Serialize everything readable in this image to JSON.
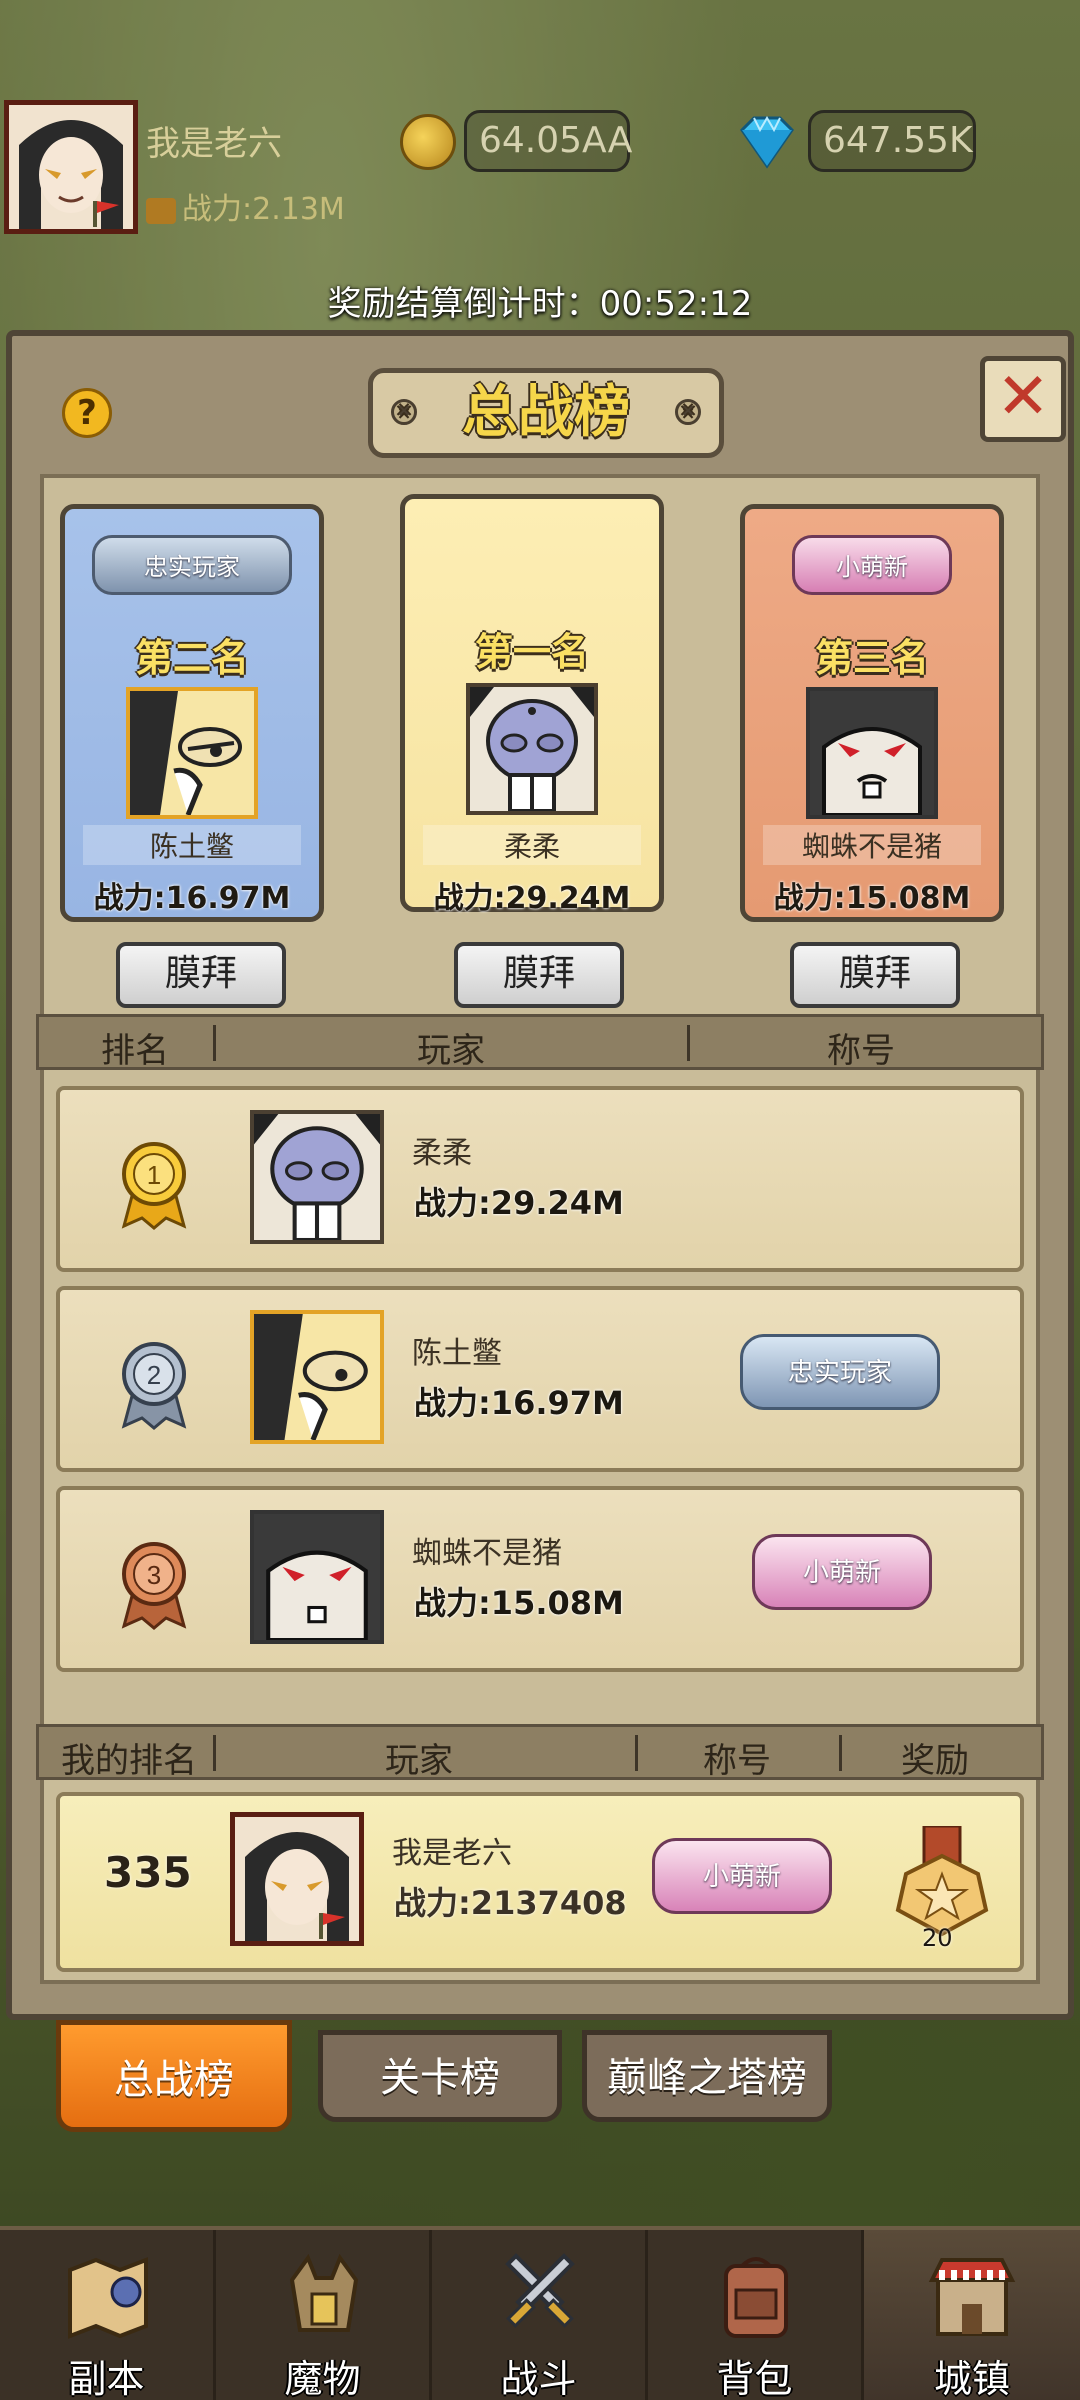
{
  "player": {
    "name": "我是老六",
    "power": "战力:2.13M",
    "gold": "64.05AA",
    "gems": "647.55K"
  },
  "countdown": "奖励结算倒计时：00:52:12",
  "panel": {
    "title": "总战榜",
    "help_label": "?",
    "close_label": "✕"
  },
  "podium": [
    {
      "rank_label": "第二名",
      "badge": "忠实玩家",
      "name": "陈土鳖",
      "power": "战力:16.97M",
      "worship": "膜拜"
    },
    {
      "rank_label": "第一名",
      "badge": "",
      "name": "柔柔",
      "power": "战力:29.24M",
      "worship": "膜拜"
    },
    {
      "rank_label": "第三名",
      "badge": "小萌新",
      "name": "蜘蛛不是猪",
      "power": "战力:15.08M",
      "worship": "膜拜"
    }
  ],
  "table_header": {
    "rank": "排名",
    "player": "玩家",
    "title": "称号"
  },
  "rows": [
    {
      "rank": "1",
      "name": "柔柔",
      "power": "战力:29.24M",
      "title": ""
    },
    {
      "rank": "2",
      "name": "陈土鳖",
      "power": "战力:16.97M",
      "title": "忠实玩家"
    },
    {
      "rank": "3",
      "name": "蜘蛛不是猪",
      "power": "战力:15.08M",
      "title": "小萌新"
    }
  ],
  "my_header": {
    "rank": "我的排名",
    "player": "玩家",
    "title": "称号",
    "reward": "奖励"
  },
  "my_row": {
    "rank": "335",
    "name": "我是老六",
    "power": "战力:2137408",
    "title": "小萌新",
    "reward_count": "20"
  },
  "tabs": [
    {
      "label": "总战榜",
      "active": true
    },
    {
      "label": "关卡榜",
      "active": false
    },
    {
      "label": "巅峰之塔榜",
      "active": false
    }
  ],
  "nav": [
    {
      "label": "副本",
      "icon": "map-icon"
    },
    {
      "label": "魔物",
      "icon": "monster-icon"
    },
    {
      "label": "战斗",
      "icon": "swords-icon"
    },
    {
      "label": "背包",
      "icon": "backpack-icon"
    },
    {
      "label": "城镇",
      "icon": "town-icon",
      "active": true
    }
  ],
  "colors": {
    "accent_gold": "#f6d64a",
    "active_tab": "#ff9b2e",
    "close_red": "#c0392b"
  }
}
